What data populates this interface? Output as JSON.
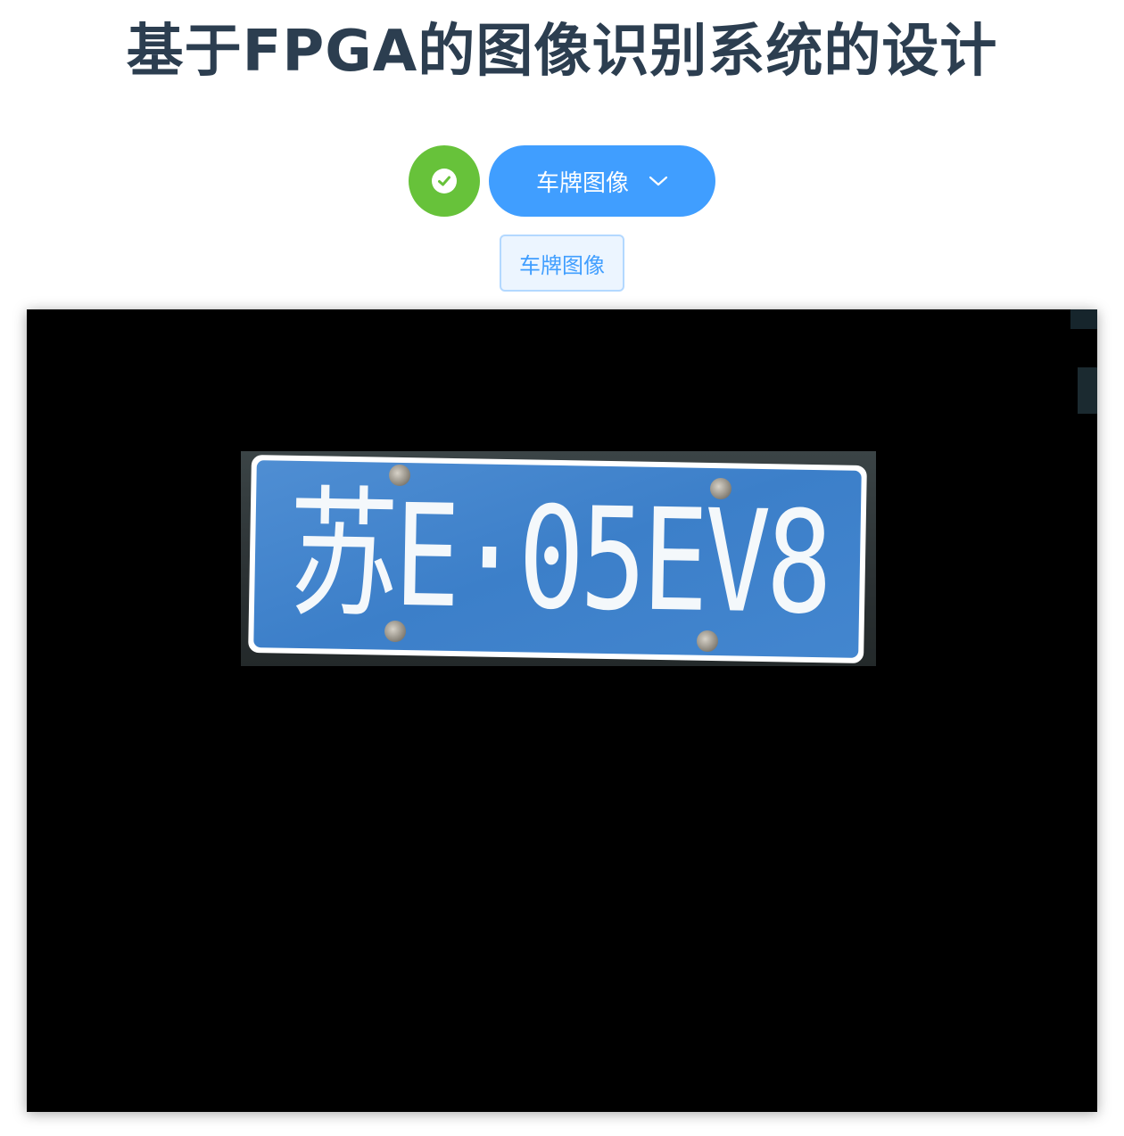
{
  "header": {
    "title": "基于FPGA的图像识别系统的设计"
  },
  "controls": {
    "status_icon": "check-circle-icon",
    "status_color": "#67c23a",
    "dropdown_label": "车牌图像",
    "dropdown_icon": "chevron-down-icon",
    "dropdown_color": "#409eff"
  },
  "tag": {
    "label": "车牌图像"
  },
  "viewer": {
    "plate_text": "苏E·05EV8",
    "plate_color": "#3c7fc9"
  }
}
